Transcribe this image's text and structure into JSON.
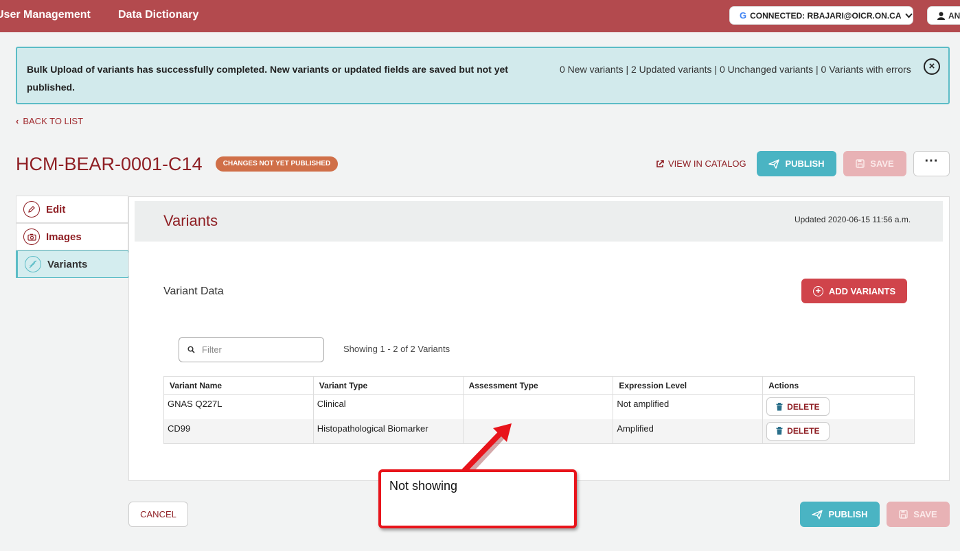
{
  "topbar": {
    "nav_items": [
      "User Management",
      "Data Dictionary"
    ],
    "connected_label": "CONNECTED: RBAJARI@OICR.ON.CA",
    "user_label": "AN"
  },
  "alert": {
    "message": "Bulk Upload of variants has successfully completed. New variants or updated fields are saved but not yet published.",
    "counts": "0 New variants | 2 Updated variants | 0 Unchanged variants | 0 Variants with errors",
    "close_glyph": "×"
  },
  "back_link": "BACK TO LIST",
  "header": {
    "title": "HCM-BEAR-0001-C14",
    "badge": "CHANGES NOT YET PUBLISHED",
    "view_catalog": "VIEW IN CATALOG",
    "publish": "PUBLISH",
    "save": "SAVE",
    "more": "···"
  },
  "sidebar": {
    "items": [
      {
        "label": "Edit",
        "icon": "pencil-icon"
      },
      {
        "label": "Images",
        "icon": "camera-icon"
      },
      {
        "label": "Variants",
        "icon": "dna-icon",
        "active": true
      }
    ]
  },
  "panel": {
    "title": "Variants",
    "updated": "Updated 2020-06-15 11:56 a.m.",
    "section_title": "Variant Data",
    "add_button": "ADD VARIANTS",
    "filter_placeholder": "Filter",
    "showing": "Showing 1 - 2 of 2 Variants"
  },
  "table": {
    "columns": [
      "Variant Name",
      "Variant Type",
      "Assessment Type",
      "Expression Level",
      "Actions"
    ],
    "rows": [
      {
        "name": "GNAS Q227L",
        "type": "Clinical",
        "assessment": "",
        "expression": "Not amplified",
        "action": "DELETE"
      },
      {
        "name": "CD99",
        "type": "Histopathological Biomarker",
        "assessment": "",
        "expression": "Amplified",
        "action": "DELETE"
      }
    ]
  },
  "footer": {
    "cancel": "CANCEL",
    "publish": "PUBLISH",
    "save": "SAVE"
  },
  "annotation": {
    "text": "Not showing",
    "color": "#e8141b"
  },
  "colors": {
    "brand": "#b34a4e",
    "accent": "#4ab4c3",
    "title": "#8f1f24",
    "badge": "#d06f48",
    "danger": "#d0444b"
  }
}
